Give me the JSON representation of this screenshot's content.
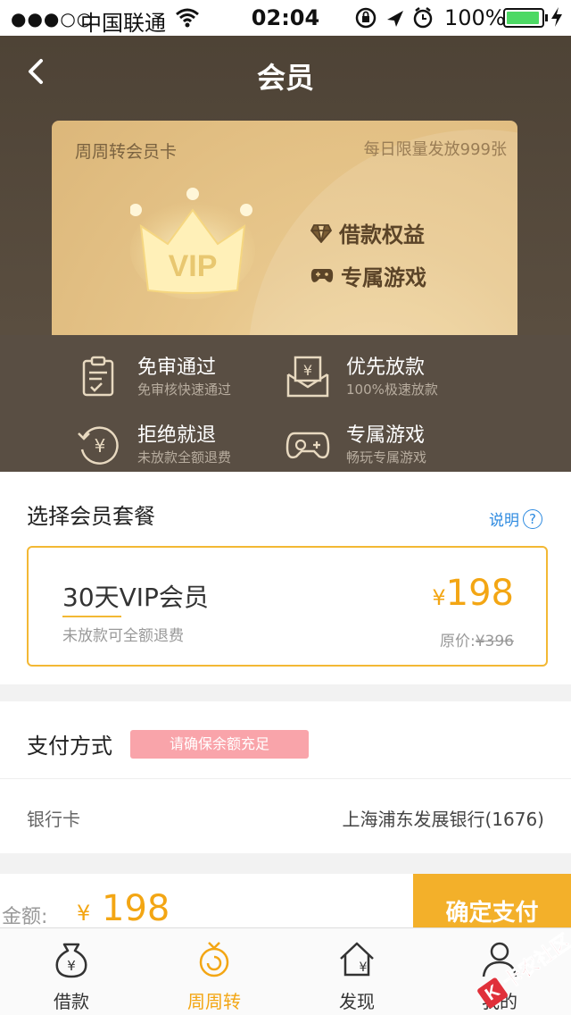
{
  "status_bar": {
    "signal_dots": "●●●○○",
    "carrier": "中国联通",
    "time": "02:04",
    "battery_percent": "100%",
    "battery_level": 1.0
  },
  "header": {
    "title": "会员"
  },
  "card": {
    "name": "周周转会员卡",
    "limit_note": "每日限量发放999张",
    "vip_text": "VIP",
    "benefits": [
      "借款权益",
      "专属游戏"
    ]
  },
  "perks": [
    {
      "title": "免审通过",
      "subtitle": "免审核快速通过",
      "icon": "clipboard-check-icon"
    },
    {
      "title": "优先放款",
      "subtitle": "100%极速放款",
      "icon": "money-envelope-icon"
    },
    {
      "title": "拒绝就退",
      "subtitle": "未放款全额退费",
      "icon": "refund-yen-icon"
    },
    {
      "title": "专属游戏",
      "subtitle": "畅玩专属游戏",
      "icon": "gamepad-icon"
    }
  ],
  "package": {
    "heading": "选择会员套餐",
    "explain_label": "说明",
    "plan_name": "30天VIP会员",
    "plan_note": "未放款可全额退费",
    "currency": "¥",
    "price": "198",
    "original_label": "原价:",
    "original_price": "¥396"
  },
  "payment": {
    "heading": "支付方式",
    "tip": "请确保余额充足",
    "method_label": "银行卡",
    "bank": "上海浦东发展银行(1676)"
  },
  "footer": {
    "amount_label": "金额:",
    "currency": "¥",
    "amount": "198",
    "confirm_label": "确定支付"
  },
  "tabs": [
    {
      "label": "借款",
      "icon": "money-bag-icon",
      "active": false
    },
    {
      "label": "周周转",
      "icon": "coin-cycle-icon",
      "active": true
    },
    {
      "label": "发现",
      "icon": "house-yen-icon",
      "active": false
    },
    {
      "label": "我的",
      "icon": "user-icon",
      "active": false
    }
  ],
  "watermark": {
    "text": "卡农社区"
  },
  "colors": {
    "accent": "#f3a614",
    "header_bg": "#4e4336",
    "tip_bg": "#f9a4aa",
    "link": "#2d8ae0"
  }
}
